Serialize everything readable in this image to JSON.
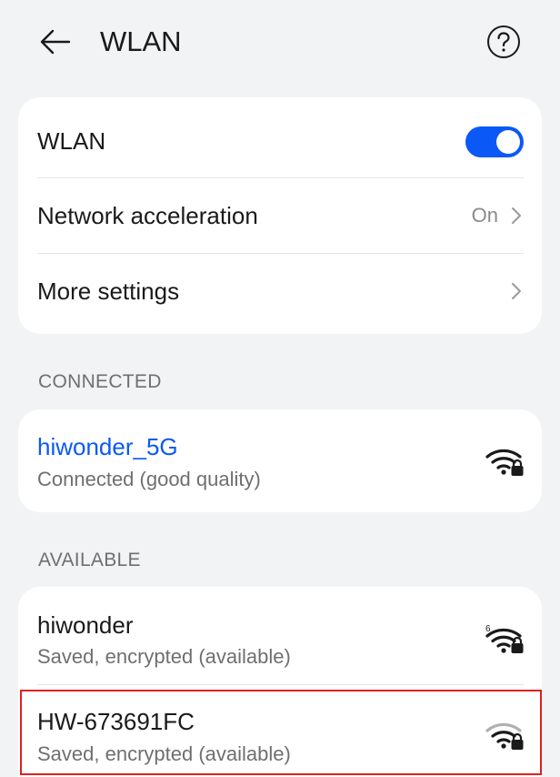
{
  "header": {
    "title": "WLAN"
  },
  "settings": {
    "wlan_label": "WLAN",
    "wlan_enabled": true,
    "acceleration_label": "Network acceleration",
    "acceleration_value": "On",
    "more_label": "More settings"
  },
  "sections": {
    "connected": "CONNECTED",
    "available": "AVAILABLE"
  },
  "connected_network": {
    "name": "hiwonder_5G",
    "status": "Connected (good quality)",
    "icon": "wifi-lock-icon"
  },
  "available_networks": [
    {
      "name": "hiwonder",
      "status": "Saved, encrypted (available)",
      "icon": "wifi-6-lock-icon"
    },
    {
      "name": "HW-673691FC",
      "status": "Saved, encrypted (available)",
      "icon": "wifi-lock-icon"
    }
  ],
  "colors": {
    "accent": "#0a59f7",
    "background": "#f1f3f5",
    "card": "#ffffff",
    "highlight": "#e02020"
  }
}
